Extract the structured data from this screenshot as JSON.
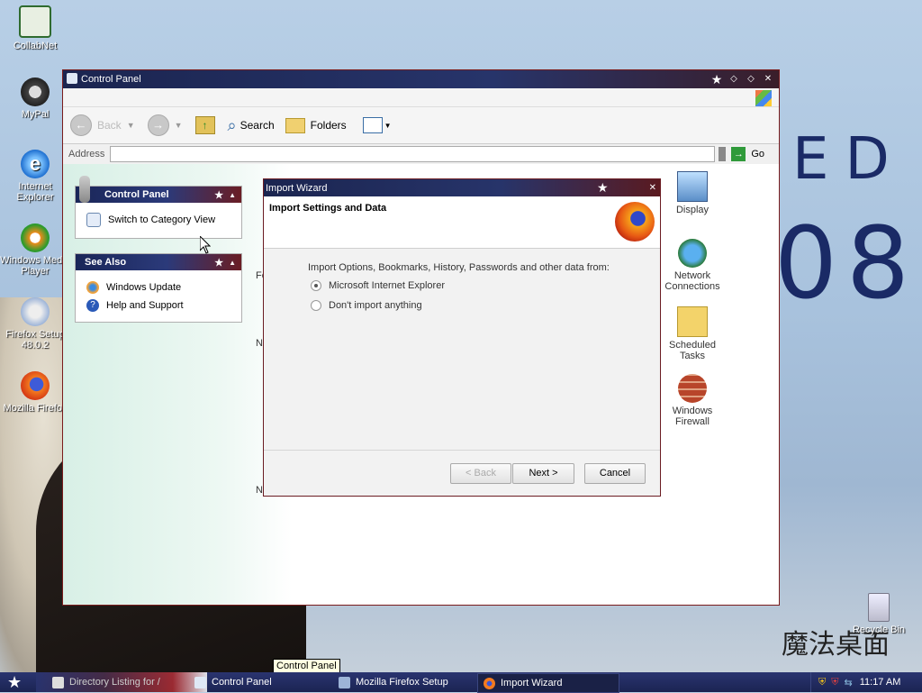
{
  "desktop": {
    "wallpaper_text_1": "ED",
    "wallpaper_text_2": "08",
    "watermark": "魔法桌面",
    "icons": [
      {
        "label": "CollabNet"
      },
      {
        "label": "MyPal"
      },
      {
        "label": "Internet Explorer"
      },
      {
        "label": "Windows Media Player"
      },
      {
        "label": "Firefox Setup 48.0.2"
      },
      {
        "label": "Mozilla Firefox"
      },
      {
        "label": "Recycle Bin"
      }
    ]
  },
  "window": {
    "title": "Control Panel",
    "toolbar": {
      "back": "Back",
      "search": "Search",
      "folders": "Folders"
    },
    "address_label": "Address",
    "go_label": "Go",
    "panels": {
      "control_panel": {
        "title": "Control Panel",
        "items": [
          {
            "label": "Switch to Category View"
          }
        ]
      },
      "see_also": {
        "title": "See Also",
        "items": [
          {
            "label": "Windows Update"
          },
          {
            "label": "Help and Support"
          }
        ]
      }
    },
    "icons": [
      {
        "label": "Display"
      },
      {
        "label": "Network Connections"
      },
      {
        "label": "Scheduled Tasks"
      },
      {
        "label": "Windows Firewall"
      }
    ],
    "partial_labels": [
      "Fo",
      "Ne",
      "Ne"
    ]
  },
  "dialog": {
    "title": "Import Wizard",
    "heading": "Import Settings and Data",
    "description": "Import Options, Bookmarks, History, Passwords and other data from:",
    "options": [
      {
        "label": "Microsoft Internet Explorer",
        "selected": true
      },
      {
        "label": "Don't import anything",
        "selected": false
      }
    ],
    "buttons": {
      "back": "< Back",
      "next": "Next >",
      "cancel": "Cancel"
    }
  },
  "taskbar": {
    "items": [
      {
        "label": "Directory Listing for /"
      },
      {
        "label": "Control Panel"
      },
      {
        "label": "Mozilla Firefox Setup"
      },
      {
        "label": "Import Wizard"
      }
    ],
    "tooltip": "Control Panel",
    "clock": "11:17 AM"
  },
  "colors": {
    "title_navy": "#1b2550",
    "accent_red": "#6b1c22",
    "firefox_orange": "#e66000"
  }
}
